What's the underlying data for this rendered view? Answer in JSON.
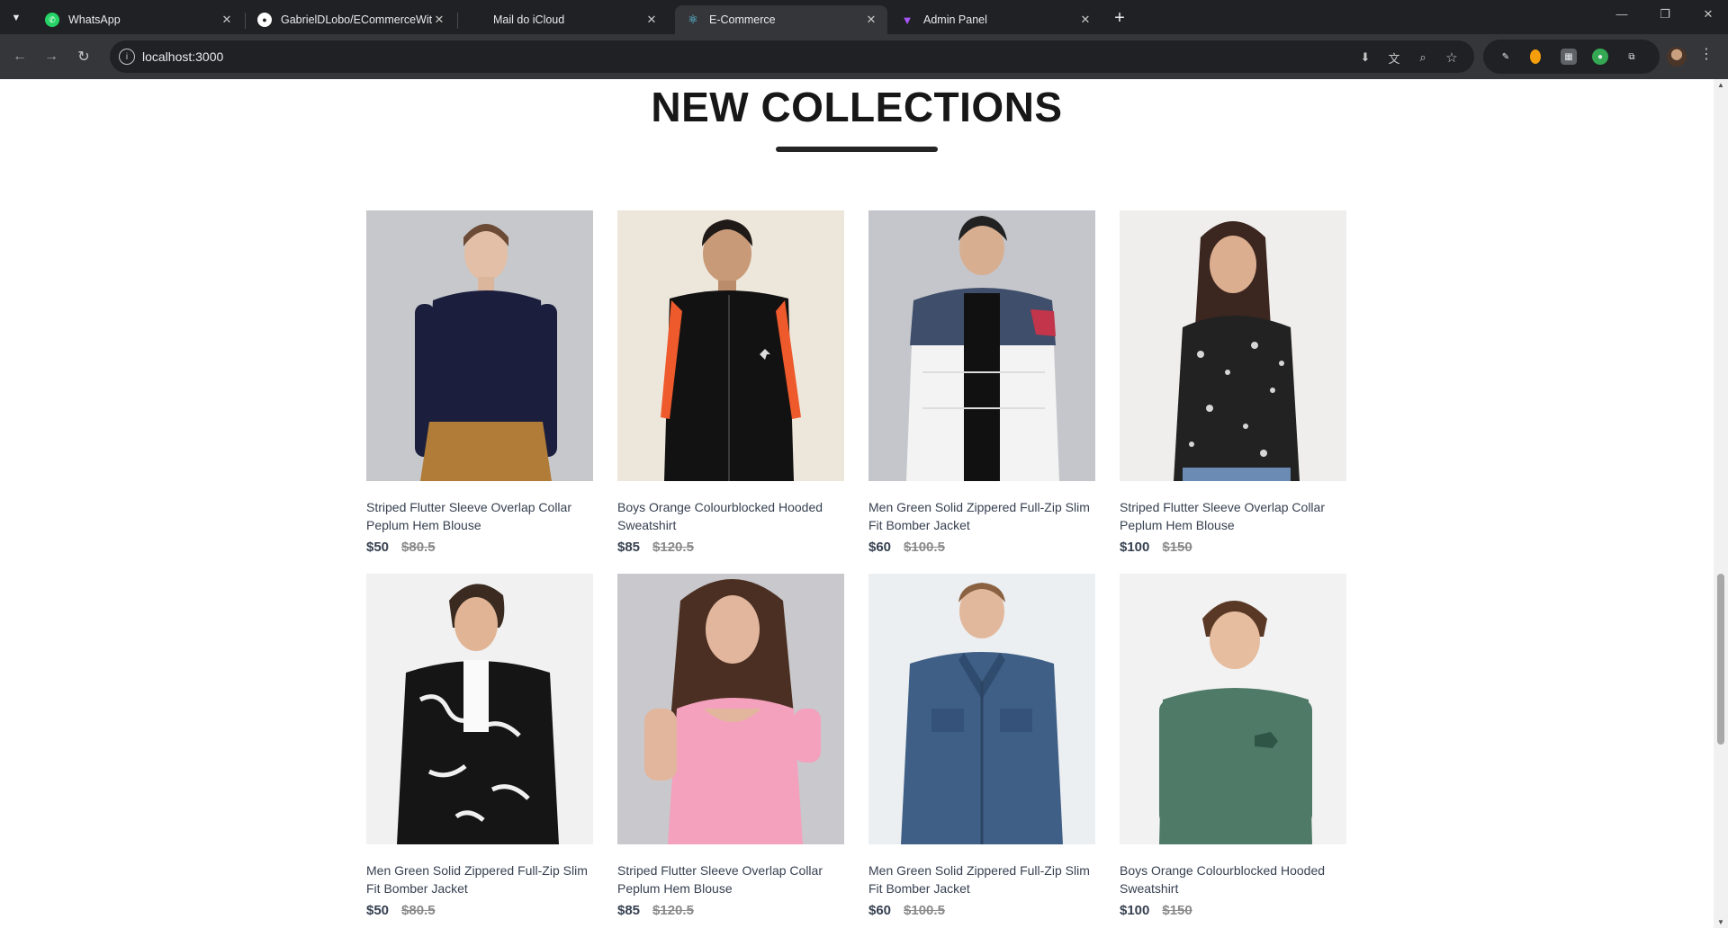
{
  "browser": {
    "tabs": [
      {
        "title": "WhatsApp",
        "icon": "whatsapp-icon",
        "color": "#25d366"
      },
      {
        "title": "GabrielDLobo/ECommerceWith",
        "icon": "github-icon",
        "color": "#ffffff"
      },
      {
        "title": "Mail do iCloud",
        "icon": "apple-icon",
        "color": "#c4c7c5"
      },
      {
        "title": "E-Commerce",
        "icon": "react-icon",
        "color": "#61dafb"
      },
      {
        "title": "Admin Panel",
        "icon": "vite-icon",
        "color": "#a855f7"
      }
    ],
    "active_tab_index": 3,
    "url": "localhost:3000"
  },
  "page": {
    "title": "NEW COLLECTIONS",
    "products": [
      {
        "name": "Striped Flutter Sleeve Overlap Collar Peplum Hem Blouse",
        "new_price": "$50",
        "old_price": "$80.5"
      },
      {
        "name": "Boys Orange Colourblocked Hooded Sweatshirt",
        "new_price": "$85",
        "old_price": "$120.5"
      },
      {
        "name": "Men Green Solid Zippered Full-Zip Slim Fit Bomber Jacket",
        "new_price": "$60",
        "old_price": "$100.5"
      },
      {
        "name": "Striped Flutter Sleeve Overlap Collar Peplum Hem Blouse",
        "new_price": "$100",
        "old_price": "$150"
      },
      {
        "name": "Men Green Solid Zippered Full-Zip Slim Fit Bomber Jacket",
        "new_price": "$50",
        "old_price": "$80.5"
      },
      {
        "name": "Striped Flutter Sleeve Overlap Collar Peplum Hem Blouse",
        "new_price": "$85",
        "old_price": "$120.5"
      },
      {
        "name": "Men Green Solid Zippered Full-Zip Slim Fit Bomber Jacket",
        "new_price": "$60",
        "old_price": "$100.5"
      },
      {
        "name": "Boys Orange Colourblocked Hooded Sweatshirt",
        "new_price": "$100",
        "old_price": "$150"
      }
    ]
  }
}
